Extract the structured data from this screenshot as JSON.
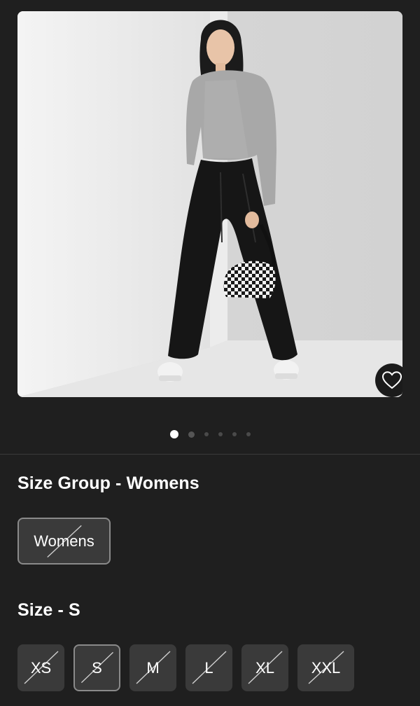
{
  "product": {
    "image_alt": "Woman in gray cable-knit sweater and black faux leather flare pants holding a checkered shoulder bag",
    "favorite_icon": "heart-outline-icon"
  },
  "carousel": {
    "count": 6,
    "active_index": 0
  },
  "size_group": {
    "title": "Size Group - Womens",
    "options": [
      {
        "label": "Womens",
        "selected": true,
        "available": false
      }
    ]
  },
  "size": {
    "title": "Size - S",
    "options": [
      {
        "label": "XS",
        "selected": false,
        "available": false
      },
      {
        "label": "S",
        "selected": true,
        "available": false
      },
      {
        "label": "M",
        "selected": false,
        "available": false
      },
      {
        "label": "L",
        "selected": false,
        "available": false
      },
      {
        "label": "XL",
        "selected": false,
        "available": false
      },
      {
        "label": "XXL",
        "selected": false,
        "available": false
      }
    ]
  },
  "colors": {
    "background": "#1f1f1f",
    "chip": "#3a3a3a",
    "chip_selected_border": "#8a8a8a"
  }
}
